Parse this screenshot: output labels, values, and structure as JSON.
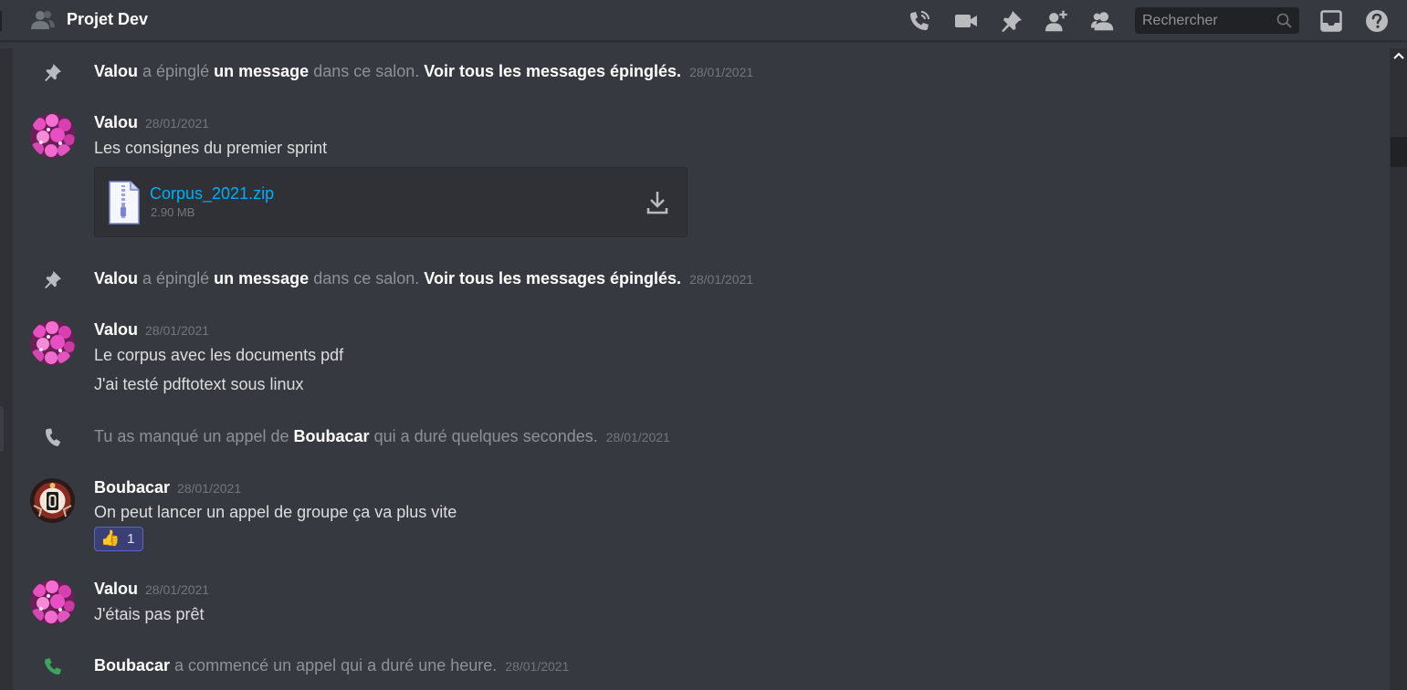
{
  "header": {
    "channel_title": "Projet Dev",
    "search_placeholder": "Rechercher",
    "icons": [
      "group-icon",
      "voice-call-icon",
      "video-call-icon",
      "pin-icon",
      "add-member-icon",
      "members-icon",
      "search-icon",
      "inbox-icon",
      "help-icon"
    ]
  },
  "colors": {
    "background": "#36393f",
    "username": "#ffffff",
    "link": "#00aff4",
    "call_green": "#3ba55c",
    "reaction_bg": "#3b4074"
  },
  "messages": [
    {
      "kind": "system-pin",
      "actor": "Valou",
      "text_1": "a épinglé",
      "link_1": "un message",
      "text_2": "dans ce salon.",
      "link_2": "Voir tous les messages épinglés.",
      "timestamp": "28/01/2021"
    },
    {
      "kind": "message",
      "author": "Valou",
      "timestamp": "28/01/2021",
      "lines": [
        "Les consignes du premier sprint"
      ],
      "attachment": {
        "name": "Corpus_2021.zip",
        "size": "2.90 MB"
      }
    },
    {
      "kind": "system-pin",
      "actor": "Valou",
      "text_1": "a épinglé",
      "link_1": "un message",
      "text_2": "dans ce salon.",
      "link_2": "Voir tous les messages épinglés.",
      "timestamp": "28/01/2021"
    },
    {
      "kind": "message",
      "author": "Valou",
      "timestamp": "28/01/2021",
      "lines": [
        "Le corpus avec les documents pdf",
        "J'ai testé pdftotext sous linux"
      ]
    },
    {
      "kind": "system-missed-call",
      "text_1": "Tu as manqué un appel de",
      "actor": "Boubacar",
      "text_2": "qui a duré quelques secondes.",
      "timestamp": "28/01/2021"
    },
    {
      "kind": "message",
      "author": "Boubacar",
      "timestamp": "28/01/2021",
      "lines": [
        "On peut lancer un appel de groupe ça va plus vite"
      ],
      "reaction": {
        "emoji": "👍",
        "count": "1"
      }
    },
    {
      "kind": "message",
      "author": "Valou",
      "timestamp": "28/01/2021",
      "lines": [
        "J'étais pas prêt"
      ]
    },
    {
      "kind": "system-call",
      "actor": "Boubacar",
      "text_1": "a commencé un appel qui a duré une heure.",
      "timestamp": "28/01/2021"
    }
  ]
}
